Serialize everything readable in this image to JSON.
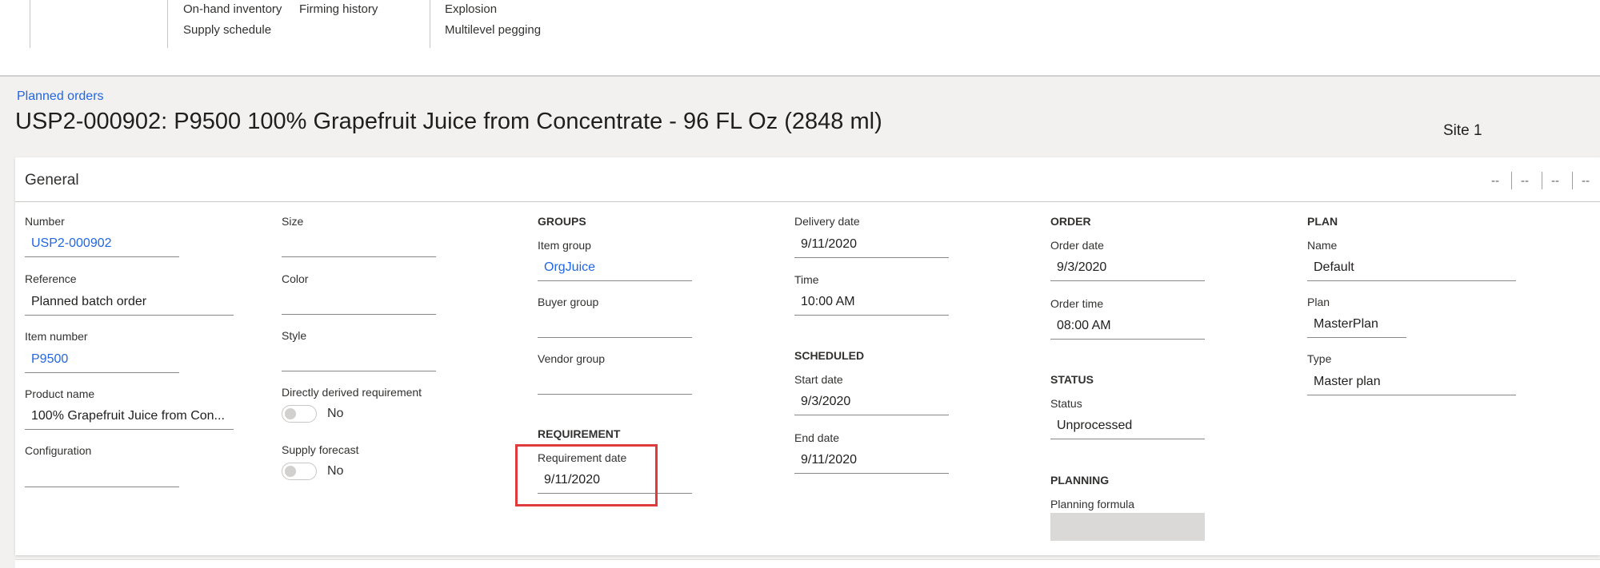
{
  "ribbon": {
    "col1": [
      "On-hand inventory",
      "Supply schedule"
    ],
    "col2": [
      "Firming history"
    ],
    "col3": [
      "Explosion",
      "Multilevel pegging"
    ]
  },
  "breadcrumb": "Planned orders",
  "title": "USP2-000902: P9500 100% Grapefruit Juice from Concentrate - 96 FL Oz (2848 ml)",
  "site": "Site 1",
  "general": {
    "title": "General",
    "summary": [
      "--",
      "--",
      "--",
      "--"
    ],
    "col1": {
      "number_label": "Number",
      "number": "USP2-000902",
      "reference_label": "Reference",
      "reference": "Planned batch order",
      "item_number_label": "Item number",
      "item_number": "P9500",
      "product_name_label": "Product name",
      "product_name": "100% Grapefruit Juice from Con...",
      "configuration_label": "Configuration",
      "configuration": ""
    },
    "col2": {
      "size_label": "Size",
      "size": "",
      "color_label": "Color",
      "color": "",
      "style_label": "Style",
      "style": "",
      "derived_label": "Directly derived requirement",
      "derived": "No",
      "supply_forecast_label": "Supply forecast",
      "supply_forecast": "No"
    },
    "col3": {
      "groups_heading": "GROUPS",
      "item_group_label": "Item group",
      "item_group": "OrgJuice",
      "buyer_group_label": "Buyer group",
      "buyer_group": "",
      "vendor_group_label": "Vendor group",
      "vendor_group": "",
      "requirement_heading": "REQUIREMENT",
      "requirement_date_label": "Requirement date",
      "requirement_date": "9/11/2020"
    },
    "col4": {
      "delivery_date_label": "Delivery date",
      "delivery_date": "9/11/2020",
      "time_label": "Time",
      "time": "10:00 AM",
      "scheduled_heading": "SCHEDULED",
      "start_date_label": "Start date",
      "start_date": "9/3/2020",
      "end_date_label": "End date",
      "end_date": "9/11/2020"
    },
    "col5": {
      "order_heading": "ORDER",
      "order_date_label": "Order date",
      "order_date": "9/3/2020",
      "order_time_label": "Order time",
      "order_time": "08:00 AM",
      "status_heading": "STATUS",
      "status_label": "Status",
      "status": "Unprocessed",
      "planning_heading": "PLANNING",
      "planning_formula_label": "Planning formula",
      "planning_formula": ""
    },
    "col6": {
      "plan_heading": "PLAN",
      "name_label": "Name",
      "name": "Default",
      "plan_label": "Plan",
      "plan": "MasterPlan",
      "type_label": "Type",
      "type": "Master plan"
    }
  },
  "colors": {
    "link": "#2266e3",
    "highlight": "#e03b3b",
    "background": "#f2f1f0"
  }
}
